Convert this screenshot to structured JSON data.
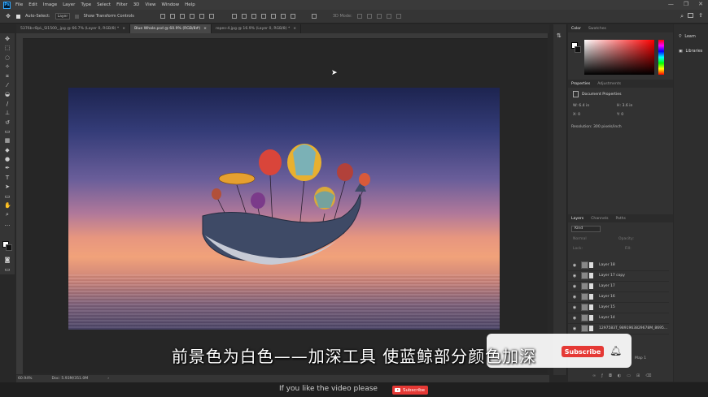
{
  "app": {
    "logo": "Ps"
  },
  "menu": [
    "File",
    "Edit",
    "Image",
    "Layer",
    "Type",
    "Select",
    "Filter",
    "3D",
    "View",
    "Window",
    "Help"
  ],
  "window_controls": [
    "—",
    "❐",
    "✕"
  ],
  "options": {
    "auto_select": "Auto-Select:",
    "layer_value": "Layer",
    "show_transform": "Show Transform Controls",
    "mode_3d": "3D Mode:"
  },
  "tabs": [
    {
      "label": "5376b-rBpL_Sl1500_.jpg @ 66.7% (Layer 0, RGB/8) *",
      "active": false
    },
    {
      "label": "Blue Whale.psd @ 60.9% (RGB/8#)",
      "active": true
    },
    {
      "label": "ropes-4.jpg @ 16.9% (Layer 0, RGB/8) *",
      "active": false
    }
  ],
  "status": {
    "zoom": "60.94%",
    "doc": "Doc: 5.93M/351.0M"
  },
  "color_panel": {
    "tabs": [
      "Color",
      "Swatches"
    ]
  },
  "properties_panel": {
    "tabs": [
      "Properties",
      "Adjustments"
    ],
    "title": "Document Properties",
    "w": "W: 6.4 in",
    "h": "H: 3.6 in",
    "x": "X: 0",
    "y": "Y: 0",
    "resolution": "Resolution: 300 pixels/inch"
  },
  "layers_panel": {
    "tabs": [
      "Layers",
      "Channels",
      "Paths"
    ],
    "kind": "Kind",
    "blend": "Normal",
    "opacity_label": "Opacity:",
    "lock_label": "Lock:",
    "fill_label": "Fill:",
    "layers": [
      "Layer 18",
      "Layer 17 copy",
      "Layer 17",
      "Layer 16",
      "Layer 15",
      "Layer 14",
      "1297583T_9891963829678M_8695..."
    ],
    "partial_right": "Map 1"
  },
  "learn_panel": {
    "items": [
      "Learn",
      "Libraries"
    ]
  },
  "subtitle": "前景色为白色——加深工具  使蓝鲸部分颜色加深",
  "overlay": {
    "subscribe": "Subscribe"
  },
  "bottom": {
    "text": "If you like the video please",
    "button": "Subscribe"
  }
}
